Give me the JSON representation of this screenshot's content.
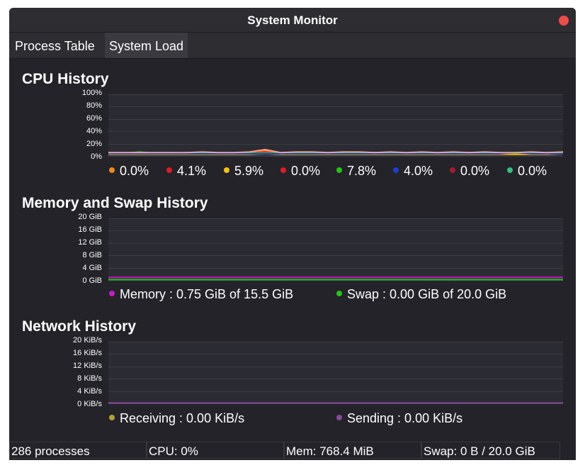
{
  "window": {
    "title": "System Monitor"
  },
  "tabs": [
    {
      "label": "Process Table",
      "active": false
    },
    {
      "label": "System Load",
      "active": true
    }
  ],
  "cpu": {
    "title": "CPU History",
    "y_ticks": [
      "100%",
      "80%",
      "60%",
      "40%",
      "20%",
      "0%"
    ],
    "legend": [
      {
        "value": "0.0%",
        "color": "#f08a1c"
      },
      {
        "value": "4.1%",
        "color": "#e01b24"
      },
      {
        "value": "5.9%",
        "color": "#f5c211"
      },
      {
        "value": "0.0%",
        "color": "#e01b24"
      },
      {
        "value": "7.8%",
        "color": "#26c21a"
      },
      {
        "value": "4.0%",
        "color": "#1c3fcf"
      },
      {
        "value": "0.0%",
        "color": "#a51d2d"
      },
      {
        "value": "0.0%",
        "color": "#2ec27e"
      }
    ]
  },
  "memory": {
    "title": "Memory and Swap History",
    "y_ticks": [
      "20 GiB",
      "16 GiB",
      "12 GiB",
      "8 GiB",
      "4 GiB",
      "0 GiB"
    ],
    "legend": [
      {
        "label": "Memory : 0.75 GiB of 15.5 GiB",
        "color": "#c61ac6"
      },
      {
        "label": "Swap : 0.00 GiB of 20.0 GiB",
        "color": "#26c21a"
      }
    ]
  },
  "network": {
    "title": "Network History",
    "y_ticks": [
      "20 KiB/s",
      "16 KiB/s",
      "12 KiB/s",
      "8 KiB/s",
      "4 KiB/s",
      "0 KiB/s"
    ],
    "legend": [
      {
        "label": "Receiving : 0.00 KiB/s",
        "color": "#b5a330"
      },
      {
        "label": "Sending : 0.00 KiB/s",
        "color": "#8a4a9e"
      }
    ]
  },
  "status": {
    "processes": "286 processes",
    "cpu": "CPU: 0%",
    "mem": "Mem: 768.4 MiB",
    "swap": "Swap: 0 B / 20.0 GiB"
  },
  "chart_data": [
    {
      "type": "line",
      "title": "CPU History",
      "ylim": [
        0,
        100
      ],
      "y_unit": "%",
      "series": [
        {
          "values": [
            4,
            4,
            5,
            4,
            4,
            5,
            4,
            4,
            4,
            5,
            8,
            4,
            5,
            4,
            4,
            4,
            4,
            5,
            4,
            4,
            4,
            4,
            4,
            5,
            4,
            4,
            4,
            4,
            4,
            6
          ],
          "color": "#f08a1c"
        },
        {
          "values": [
            3,
            3,
            3,
            4,
            3,
            3,
            3,
            3,
            3,
            4,
            6,
            3,
            3,
            3,
            3,
            3,
            4,
            3,
            3,
            3,
            3,
            4,
            3,
            3,
            3,
            3,
            3,
            4,
            3,
            4
          ],
          "color": "#e01b24"
        },
        {
          "values": [
            2,
            2,
            2,
            2,
            2,
            2,
            2,
            2,
            2,
            2,
            3,
            2,
            2,
            2,
            2,
            2,
            2,
            2,
            2,
            2,
            2,
            2,
            2,
            2,
            2,
            2,
            2,
            2,
            2,
            3
          ],
          "color": "#f5c211"
        },
        {
          "values": [
            5,
            4,
            6,
            4,
            5,
            4,
            5,
            4,
            4,
            4,
            4,
            4,
            4,
            4,
            4,
            4,
            4,
            4,
            4,
            4,
            4,
            4,
            4,
            4,
            4,
            4,
            4,
            4,
            4,
            4
          ],
          "color": "#26c21a"
        },
        {
          "values": [
            3,
            3,
            3,
            3,
            3,
            3,
            3,
            3,
            3,
            3,
            3,
            3,
            3,
            3,
            3,
            3,
            3,
            3,
            3,
            3,
            3,
            3,
            3,
            3,
            3,
            3,
            5,
            3,
            3,
            3
          ],
          "color": "#1c3fcf"
        },
        {
          "values": [
            5,
            5,
            5,
            5,
            5,
            5,
            6,
            5,
            5,
            6,
            10,
            5,
            6,
            6,
            5,
            6,
            6,
            5,
            6,
            5,
            6,
            5,
            6,
            5,
            6,
            5,
            5,
            6,
            5,
            6
          ],
          "color": "#f4a58a"
        }
      ]
    },
    {
      "type": "line",
      "title": "Memory and Swap History",
      "ylim": [
        0,
        20
      ],
      "y_unit": "GiB",
      "series": [
        {
          "values": [
            0.75,
            0.75
          ],
          "color": "#c61ac6"
        },
        {
          "values": [
            0.0,
            0.0
          ],
          "color": "#26c21a"
        }
      ]
    },
    {
      "type": "line",
      "title": "Network History",
      "ylim": [
        0,
        20
      ],
      "y_unit": "KiB/s",
      "series": [
        {
          "values": [
            0.0,
            0.0
          ],
          "color": "#f5e66e"
        },
        {
          "values": [
            0.0,
            0.0
          ],
          "color": "#8a4a9e"
        }
      ]
    }
  ]
}
